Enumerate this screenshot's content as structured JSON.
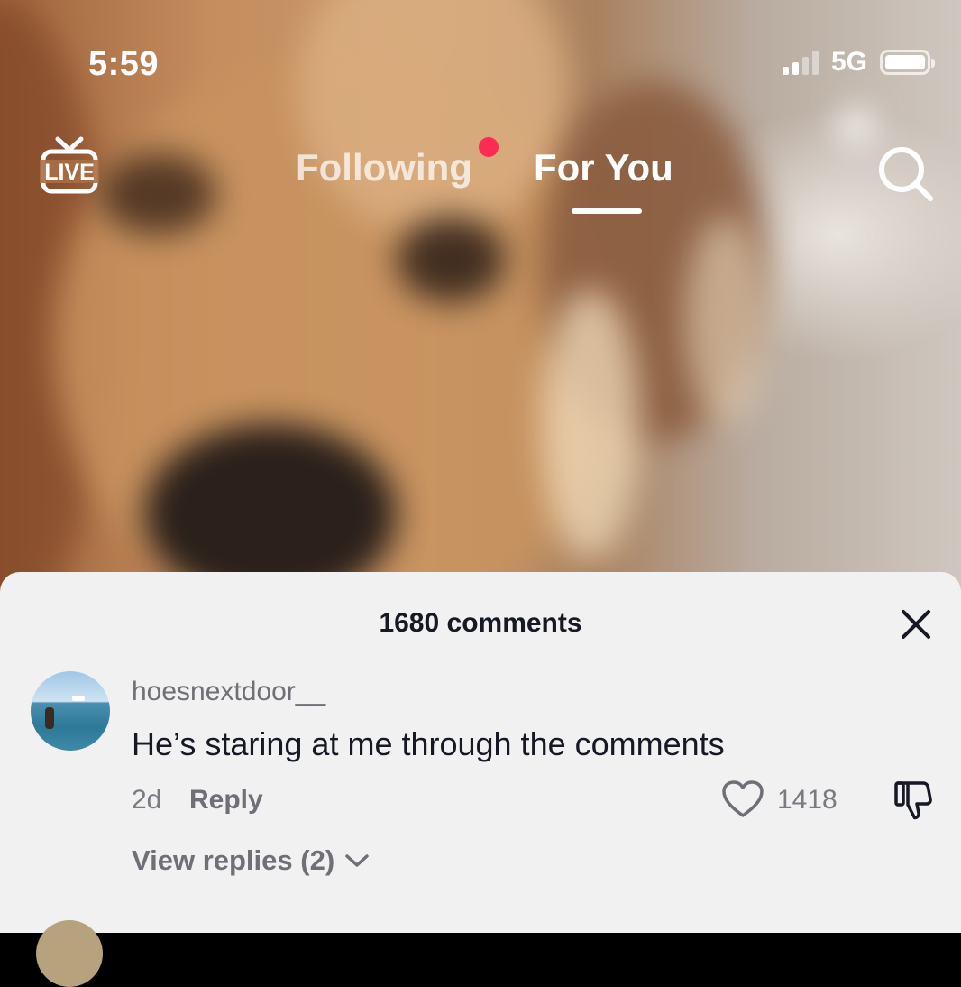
{
  "status_bar": {
    "time": "5:59",
    "network": "5G"
  },
  "top_nav": {
    "live_label": "LIVE",
    "tabs": [
      {
        "label": "Following",
        "active": false,
        "has_notification_dot": true
      },
      {
        "label": "For You",
        "active": true
      }
    ],
    "search_icon": "search-icon"
  },
  "colors": {
    "accent_red": "#fe2c55",
    "sheet_background": "#f1f1f2",
    "primary_text": "#161823",
    "secondary_text": "#7a7b81"
  },
  "comments_panel": {
    "title": "1680 comments",
    "close_icon": "close-icon",
    "comments": [
      {
        "username": "hoesnextdoor__",
        "text": "He’s staring at me through the comments",
        "age": "2d",
        "reply_label": "Reply",
        "like_count": "1418",
        "view_replies_label": "View replies (2)"
      }
    ]
  }
}
